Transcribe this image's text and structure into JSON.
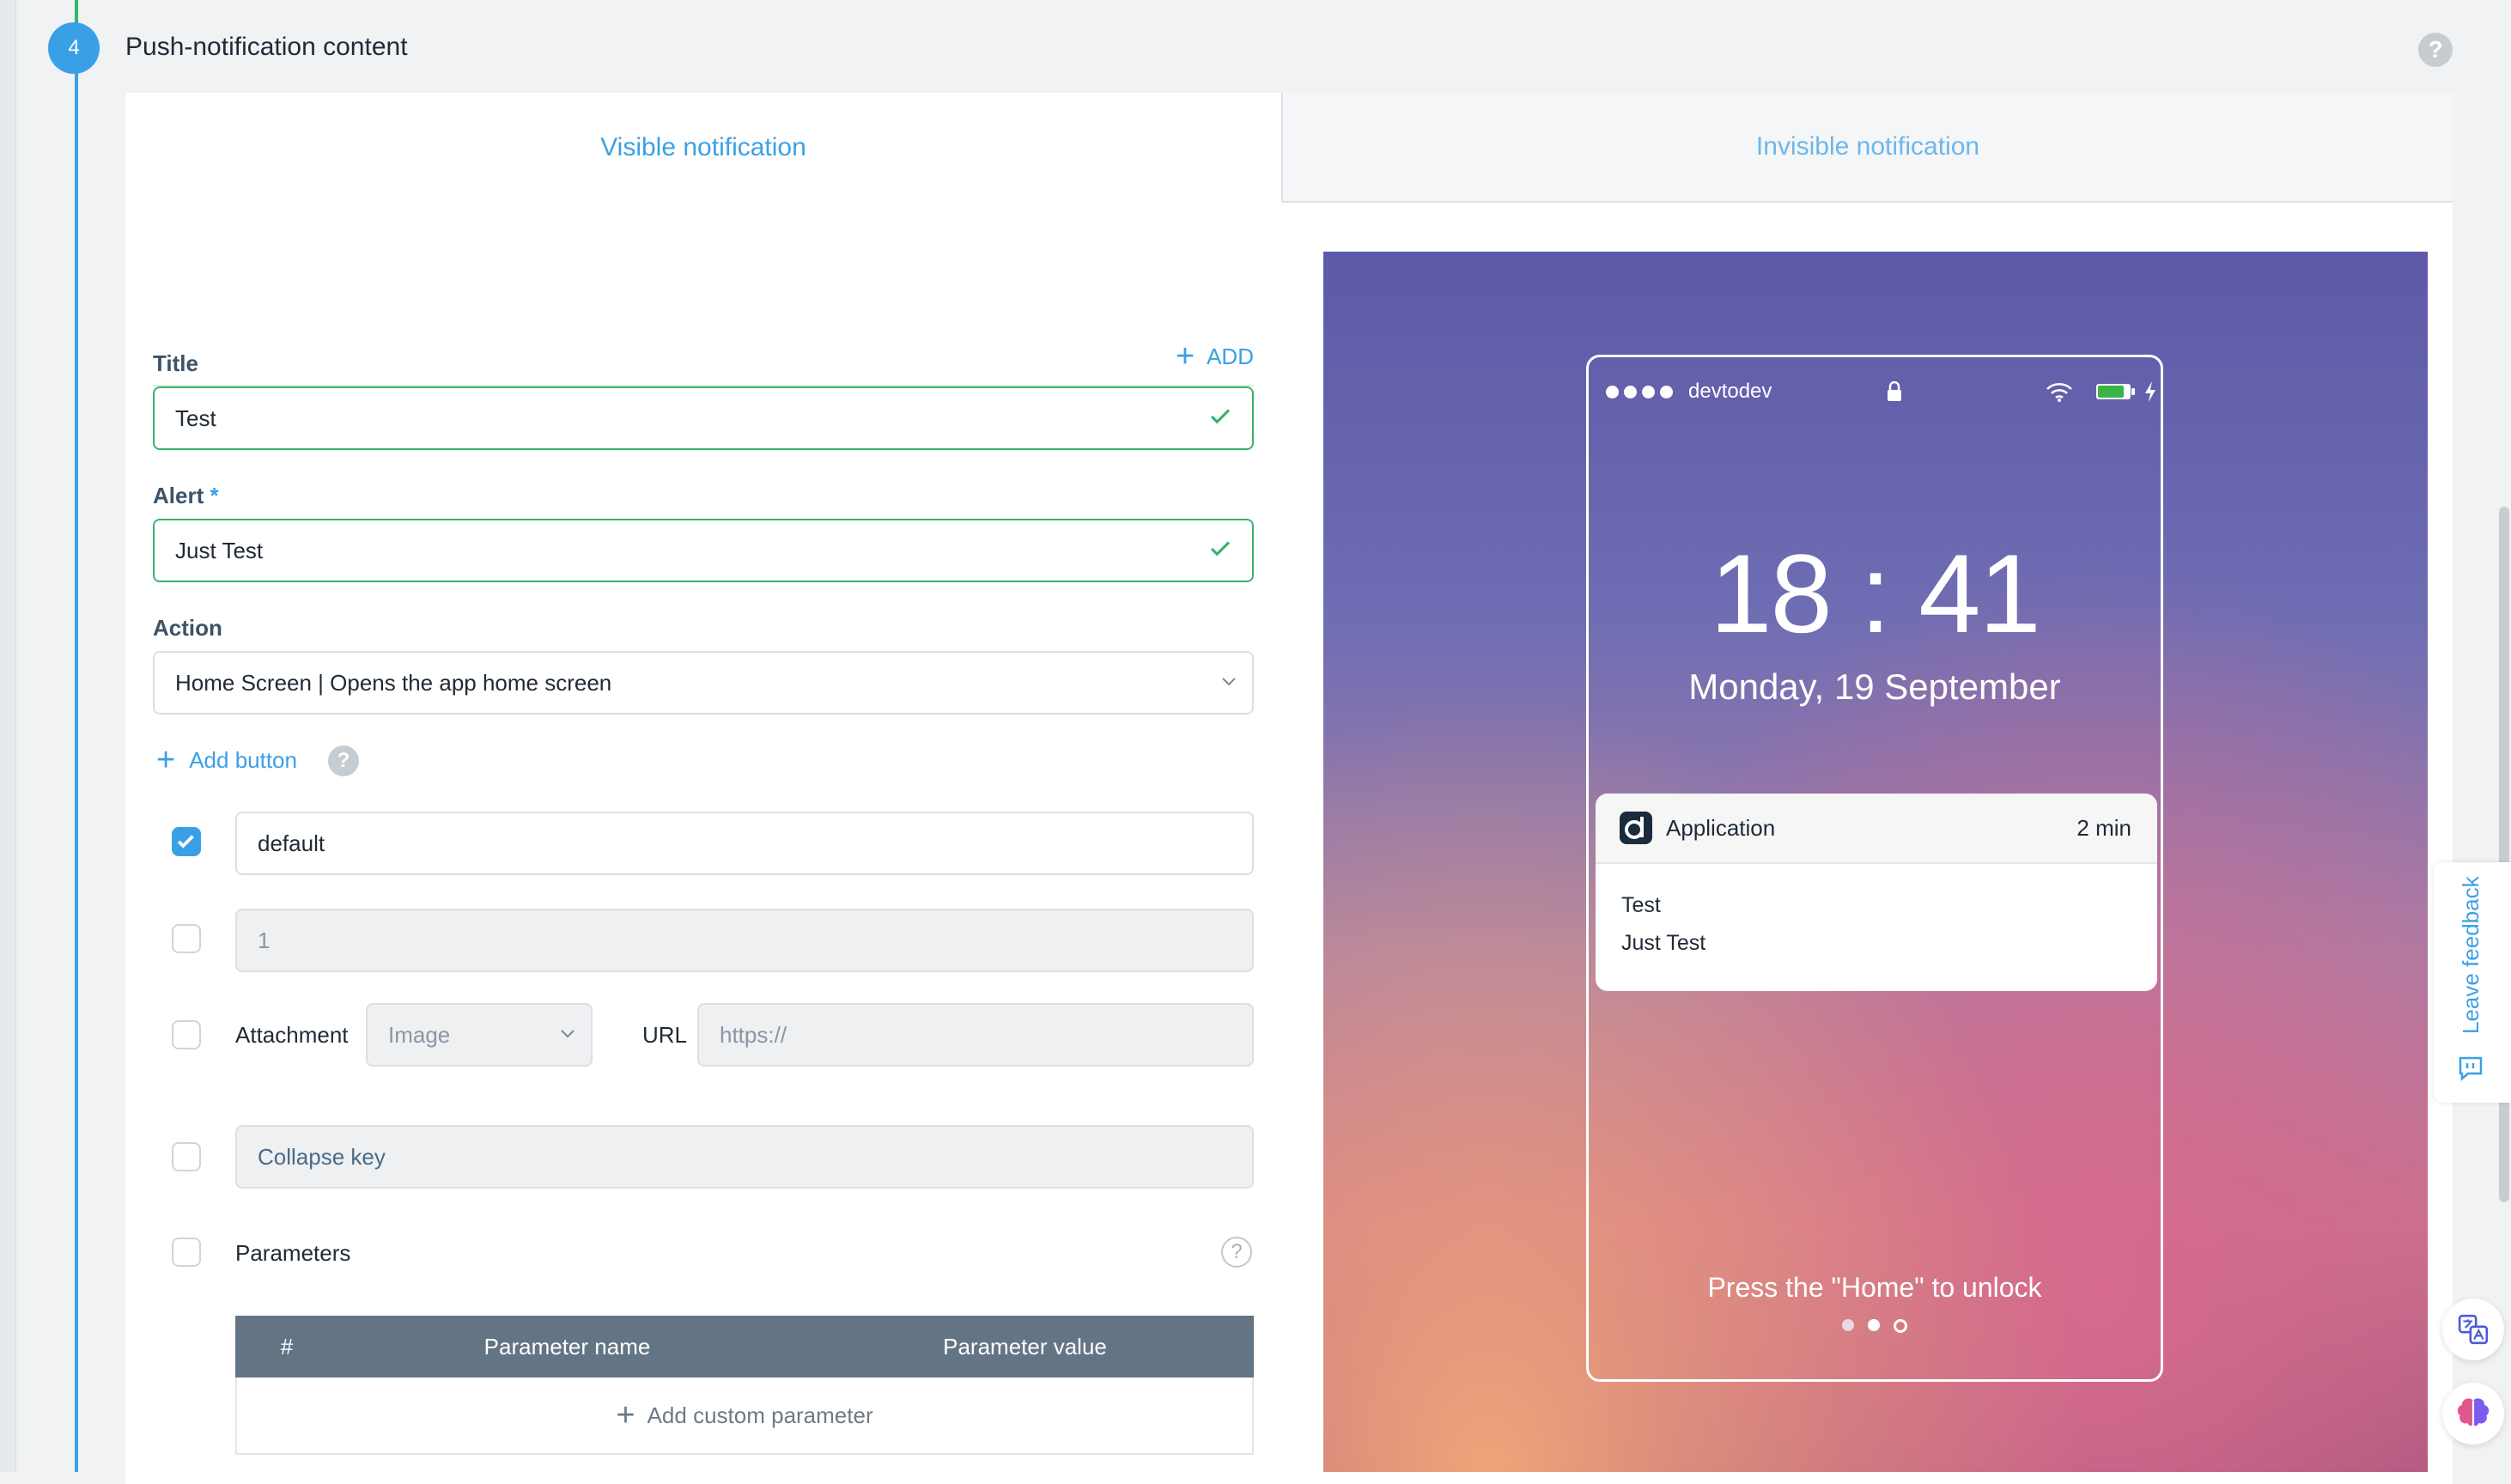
{
  "step": {
    "number": "4",
    "title": "Push-notification content"
  },
  "tabs": [
    {
      "label": "Visible notification",
      "active": true
    },
    {
      "label": "Invisible notification",
      "active": false
    }
  ],
  "add_link": {
    "label": "ADD"
  },
  "form": {
    "title_label": "Title",
    "title_value": "Test",
    "alert_label": "Alert",
    "alert_required": "*",
    "alert_value": "Just Test",
    "action_label": "Action",
    "action_value": "Home Screen | Opens the app home screen",
    "add_button_label": "Add button",
    "help_glyph": "?",
    "options": {
      "sound": {
        "checked": true,
        "value": "default"
      },
      "badge": {
        "checked": false,
        "value": "1"
      },
      "attachment": {
        "checked": false,
        "label": "Attachment",
        "type_value": "Image",
        "url_label": "URL",
        "url_placeholder": "https://"
      },
      "collapse": {
        "checked": false,
        "placeholder": "Collapse key"
      },
      "parameters": {
        "checked": false,
        "label": "Parameters"
      }
    },
    "param_table": {
      "columns": [
        "#",
        "Parameter name",
        "Parameter value"
      ],
      "add_label": "Add custom parameter"
    }
  },
  "preview": {
    "carrier": "devtodev",
    "time": "18 : 41",
    "date": "Monday, 19 September",
    "notification": {
      "app": "Application",
      "ago": "2 min",
      "title": "Test",
      "body": "Just Test"
    },
    "unlock_text": "Press the \"Home\" to unlock"
  },
  "feedback": {
    "label": "Leave feedback"
  },
  "colors": {
    "accent": "#3aa0e6",
    "valid": "#37b36e",
    "table_header": "#637585"
  }
}
